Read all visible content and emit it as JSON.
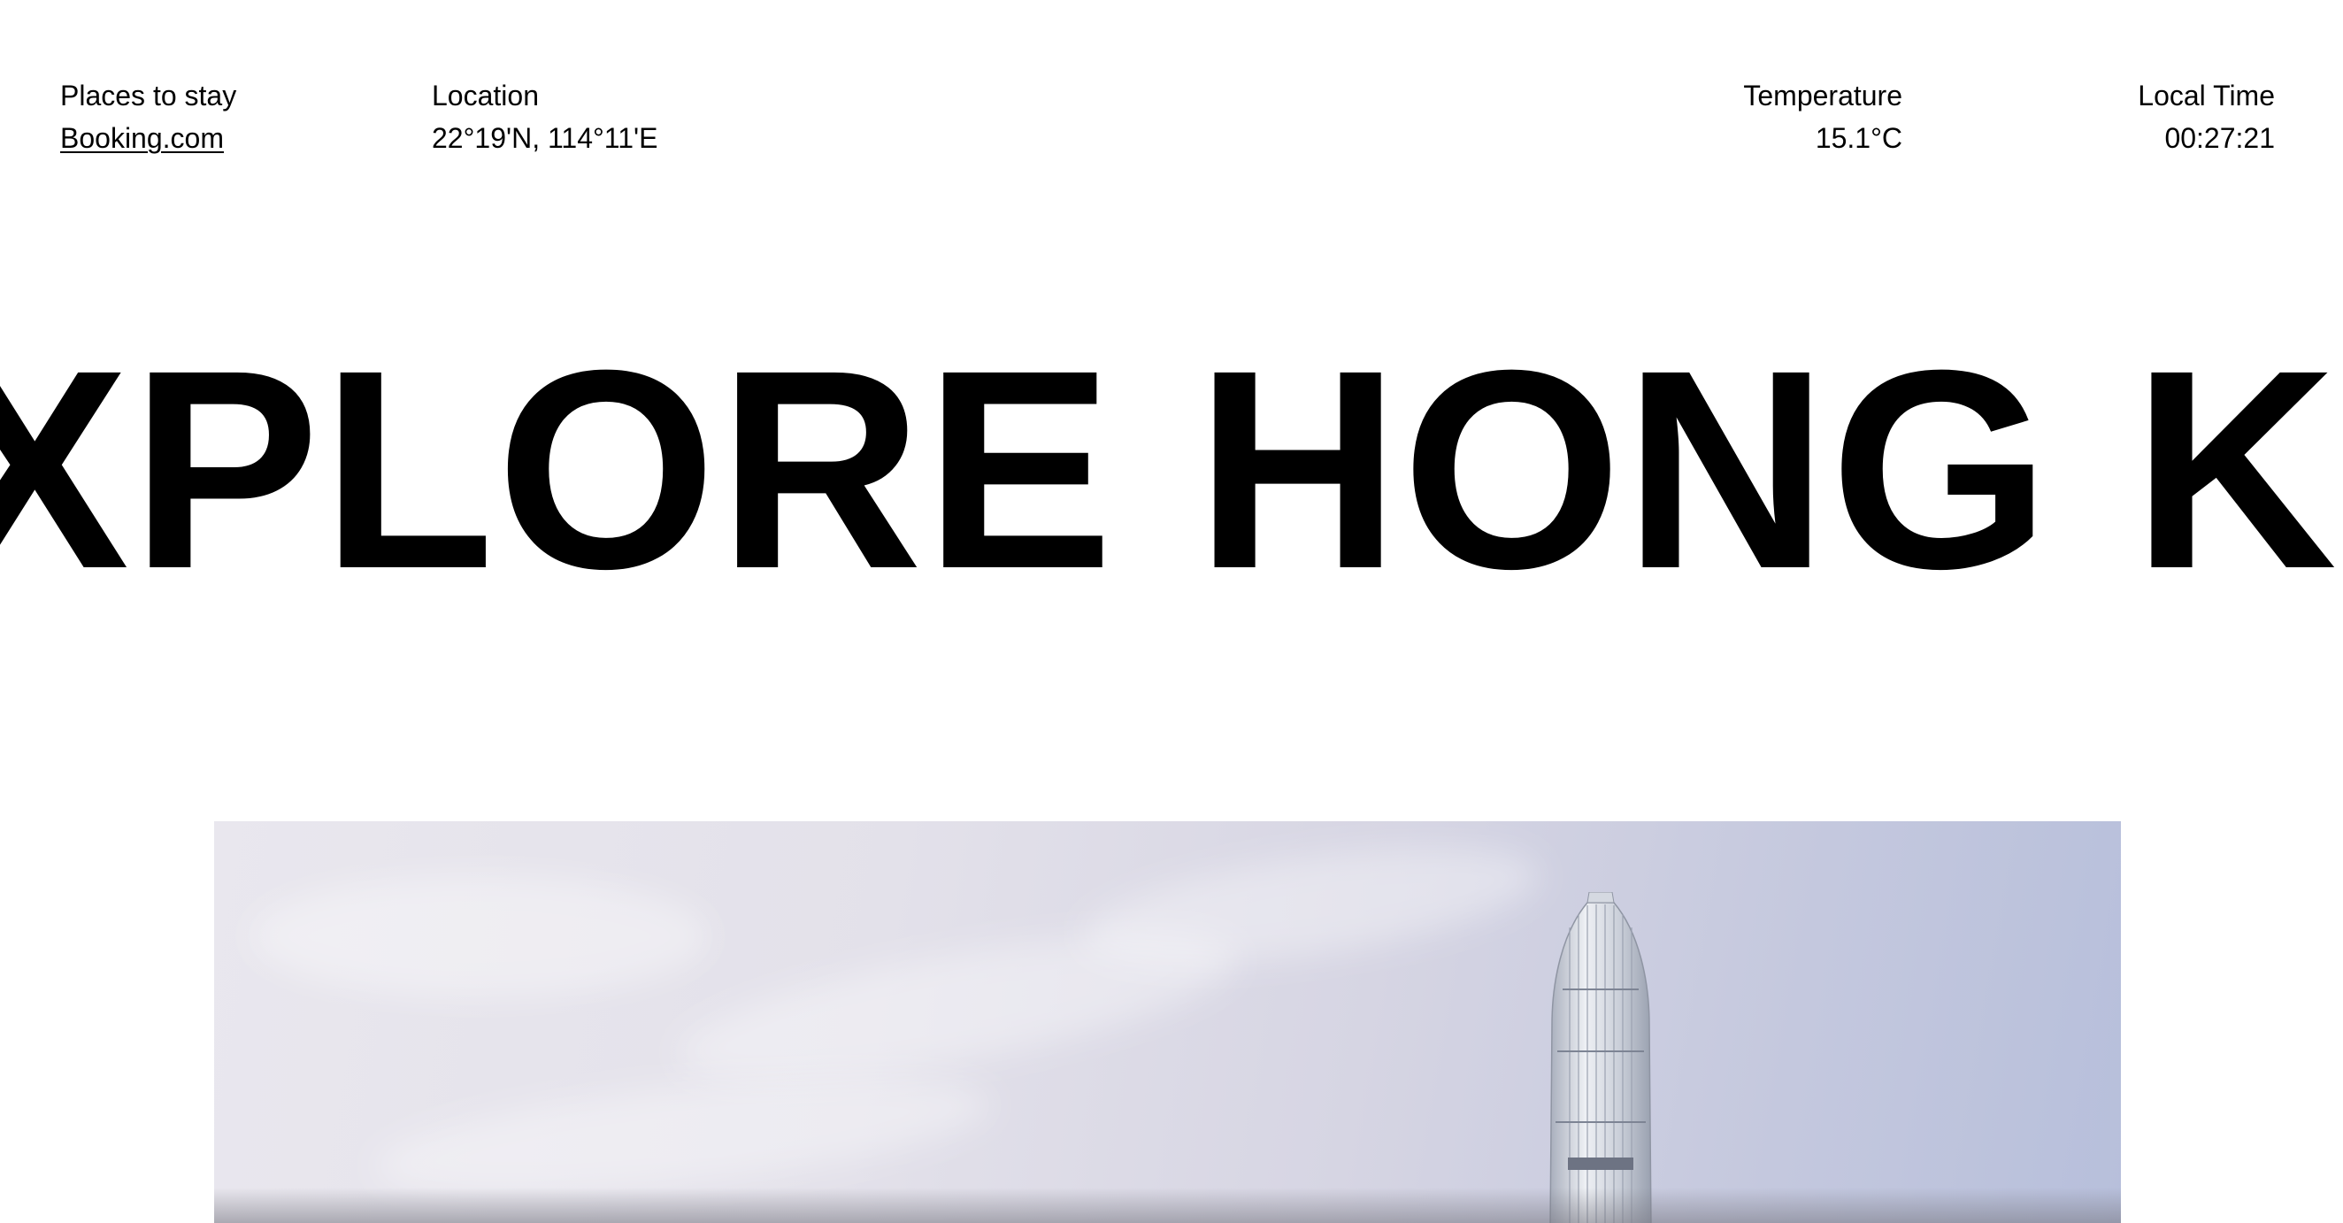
{
  "info": {
    "stay": {
      "label": "Places to stay",
      "link": "Booking.com"
    },
    "location": {
      "label": "Location",
      "value": "22°19'N, 114°11'E"
    },
    "temperature": {
      "label": "Temperature",
      "value": "15.1°C"
    },
    "time": {
      "label": "Local Time",
      "value": "00:27:21"
    }
  },
  "headline": {
    "text": "EXPLORE HONG KONG EXPLORE"
  },
  "hero": {
    "icon": "skyline-photo"
  },
  "colors": {
    "text": "#000000",
    "background": "#ffffff",
    "sky_light": "#e9e7ee",
    "sky_blue": "#b7bfdb"
  }
}
